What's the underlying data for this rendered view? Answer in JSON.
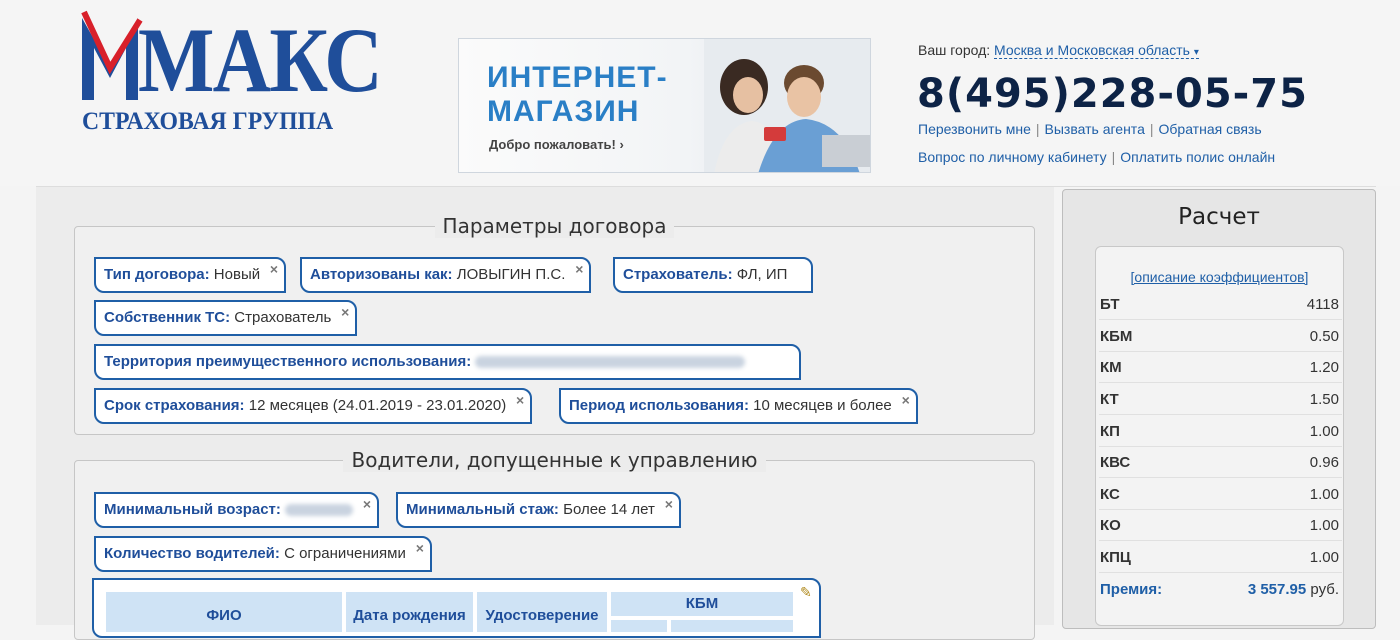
{
  "logo": {
    "word": "МАКС",
    "subtitle": "СТРАХОВАЯ ГРУППА"
  },
  "banner": {
    "line1": "ИНТЕРНЕТ-",
    "line2": "МАГАЗИН",
    "sub": "Добро пожаловать!"
  },
  "header": {
    "city_label": "Ваш город:",
    "city_value": "Москва и Московская область",
    "phone": "8(495)228-05-75",
    "links_row1": [
      "Перезвонить мне",
      "Вызвать агента",
      "Обратная связь"
    ],
    "links_row2": [
      "Вопрос по личному кабинету",
      "Оплатить полис онлайн"
    ]
  },
  "contract": {
    "legend": "Параметры договора",
    "chips": [
      {
        "label": "Тип договора:",
        "value": "Новый"
      },
      {
        "label": "Авторизованы как:",
        "value": "ЛОВЫГИН П.С."
      },
      {
        "label": "Страхователь:",
        "value": "ФЛ, ИП"
      },
      {
        "label": "Собственник ТС:",
        "value": "Страхователь"
      },
      {
        "label": "Территория преимущественного использования:",
        "value": ""
      },
      {
        "label": "Срок страхования:",
        "value": "12 месяцев (24.01.2019 - 23.01.2020)"
      },
      {
        "label": "Период использования:",
        "value": "10 месяцев и более"
      }
    ]
  },
  "drivers": {
    "legend": "Водители, допущенные к управлению",
    "chips": [
      {
        "label": "Минимальный возраст:",
        "value": ""
      },
      {
        "label": "Минимальный стаж:",
        "value": "Более 14 лет"
      },
      {
        "label": "Количество водителей:",
        "value": "С ограничениями"
      }
    ],
    "table_headers": [
      "ФИО",
      "Дата рождения",
      "Удостоверение",
      "КБМ"
    ]
  },
  "calc": {
    "title": "Расчет",
    "link": "[описание коэффициентов]",
    "rows": [
      {
        "k": "БТ",
        "v": "4118"
      },
      {
        "k": "КБМ",
        "v": "0.50"
      },
      {
        "k": "КМ",
        "v": "1.20"
      },
      {
        "k": "КТ",
        "v": "1.50"
      },
      {
        "k": "КП",
        "v": "1.00"
      },
      {
        "k": "КВС",
        "v": "0.96"
      },
      {
        "k": "КС",
        "v": "1.00"
      },
      {
        "k": "КО",
        "v": "1.00"
      },
      {
        "k": "КПЦ",
        "v": "1.00"
      }
    ],
    "premium_label": "Премия:",
    "premium_value": "3 557.95",
    "premium_unit": "руб."
  },
  "colors": {
    "brand": "#1f4e9a",
    "link": "#1f5fa7",
    "logo_red": "#d8202a"
  }
}
